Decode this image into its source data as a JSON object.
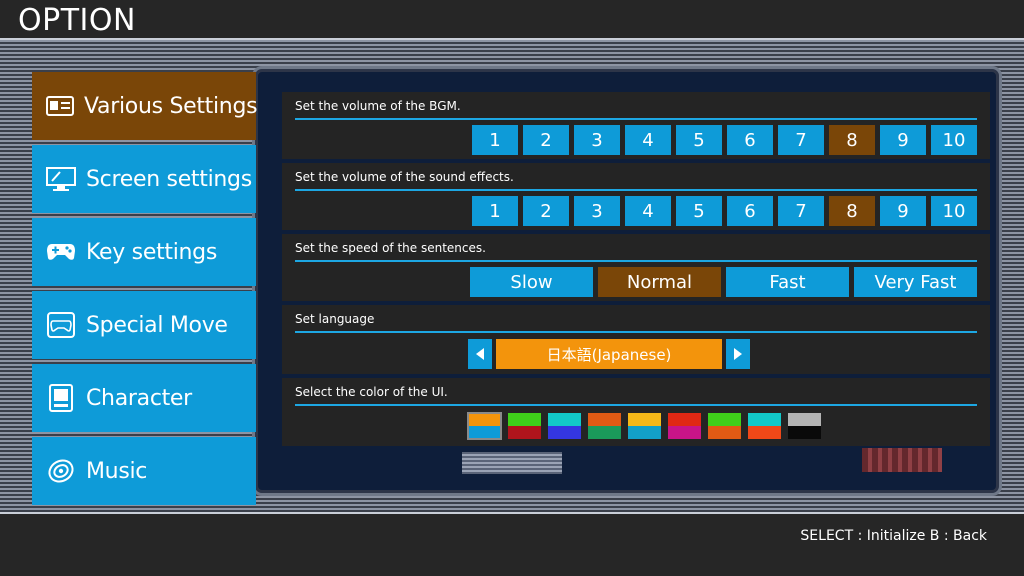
{
  "screen": {
    "title": "OPTION"
  },
  "sidebar": {
    "items": [
      {
        "label": "Various Settings",
        "icon": "id-card-icon"
      },
      {
        "label": "Screen settings",
        "icon": "monitor-icon"
      },
      {
        "label": "Key settings",
        "icon": "gamepad-icon"
      },
      {
        "label": "Special Move",
        "icon": "special-move-icon"
      },
      {
        "label": "Character",
        "icon": "character-icon"
      },
      {
        "label": "Music",
        "icon": "disc-icon"
      }
    ],
    "active_index": 0
  },
  "settings": {
    "bgm": {
      "title": "Set the volume of the BGM.",
      "options": [
        "1",
        "2",
        "3",
        "4",
        "5",
        "6",
        "7",
        "8",
        "9",
        "10"
      ],
      "selected": "8"
    },
    "se": {
      "title": "Set the volume of the sound effects.",
      "options": [
        "1",
        "2",
        "3",
        "4",
        "5",
        "6",
        "7",
        "8",
        "9",
        "10"
      ],
      "selected": "8"
    },
    "speed": {
      "title": "Set the speed of the sentences.",
      "options": [
        "Slow",
        "Normal",
        "Fast",
        "Very Fast"
      ],
      "selected": "Normal"
    },
    "language": {
      "title": "Set language",
      "value": "日本語(Japanese)"
    },
    "ui_color": {
      "title": "Select the color of the UI.",
      "swatches": [
        [
          "#f3940c",
          "#0e9bd8"
        ],
        [
          "#3fcf1a",
          "#b0141c"
        ],
        [
          "#12c8c8",
          "#3436e0"
        ],
        [
          "#e05a14",
          "#1a9a5a"
        ],
        [
          "#f5b818",
          "#12a0c8"
        ],
        [
          "#e02814",
          "#c81488"
        ],
        [
          "#3fcf1a",
          "#e05a14"
        ],
        [
          "#12c8c8",
          "#f04818"
        ],
        [
          "#b4b4b4",
          "#0a0a0a"
        ]
      ],
      "selected_index": 0
    }
  },
  "colors": {
    "accent": "#0e9bd8",
    "selected": "#7a4608",
    "language_value": "#f3940c"
  },
  "footer": {
    "hint": "SELECT : Initialize  B : Back"
  }
}
